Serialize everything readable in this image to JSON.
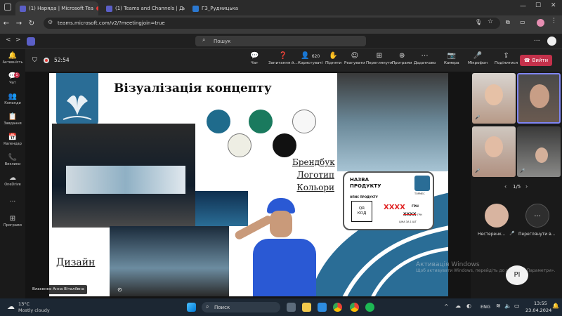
{
  "browser": {
    "tabs": [
      {
        "label": "(1) Наряда | Microsoft Tea",
        "active": true,
        "recording": true
      },
      {
        "label": "(1) Teams and Channels | Ди",
        "active": false
      },
      {
        "label": "ГЗ_Рудницька",
        "active": false
      }
    ],
    "url": "teams.microsoft.com/v2/?meetingjoin=true"
  },
  "teams": {
    "search_placeholder": "Пошук",
    "more": "...",
    "rail": [
      {
        "icon": "bell-icon",
        "label": "Активність"
      },
      {
        "icon": "chat-icon",
        "label": "Чат",
        "badge": "1"
      },
      {
        "icon": "teams-icon",
        "label": "Команди"
      },
      {
        "icon": "assignments-icon",
        "label": "Завдання"
      },
      {
        "icon": "calendar-icon",
        "label": "Календар"
      },
      {
        "icon": "calls-icon",
        "label": "Виклики"
      },
      {
        "icon": "onedrive-icon",
        "label": "OneDrive"
      },
      {
        "icon": "more-icon",
        "label": "..."
      },
      {
        "icon": "apps-icon",
        "label": "Програми"
      }
    ],
    "meeting": {
      "timer": "52:54",
      "buttons": [
        {
          "icon": "chat-icon",
          "label": "Чат"
        },
        {
          "icon": "qa-icon",
          "label": "Запитання й..."
        },
        {
          "icon": "people-icon",
          "label": "Користувачі",
          "count": "620"
        },
        {
          "icon": "raise-hand-icon",
          "label": "Підняти"
        },
        {
          "icon": "react-icon",
          "label": "Реагувати"
        },
        {
          "icon": "view-icon",
          "label": "Переглянути"
        },
        {
          "icon": "apps-icon",
          "label": "Програми"
        },
        {
          "icon": "more-icon",
          "label": "Додатково"
        },
        {
          "icon": "camera-icon",
          "label": "Камера"
        },
        {
          "icon": "mic-icon",
          "label": "Мікрофон"
        },
        {
          "icon": "share-icon",
          "label": "Поділитися"
        }
      ],
      "leave_label": "Вийти"
    },
    "slide": {
      "title": "Візуалізація концепту",
      "labels": [
        "Брендбук",
        "Логотип",
        "Кольори"
      ],
      "design_label": "Дизайн",
      "colors": [
        "#1f6b8c",
        "#1a7a5e",
        "#f7f7f7",
        "#eeeee4",
        "#111111"
      ],
      "price_card": {
        "name_line1": "НАЗВА",
        "name_line2": "ПРОДУКТУ",
        "description": "ОПИС ПРОДУКТУ",
        "qr_line1": "QR",
        "qr_line2": "КОД",
        "price": "XXXX",
        "old_price": "XXXX",
        "currency": "ГРН",
        "unit_price": "ЦІНА ЗА 1 ШТ",
        "brand": "ТОРМЕС"
      }
    },
    "presenter_name": "Власенко Анна Віталіївна",
    "side_panel": {
      "page": "1/5",
      "participants": [
        {
          "name": "Нестеренк...",
          "initials": ""
        },
        {
          "name": "Переглянути в...",
          "initials": "..."
        }
      ],
      "overlay_initials": "PI"
    },
    "watermark": {
      "title": "Активація Windows",
      "subtitle": "Щоб активувати Windows, перейдіть до розділу «Параметри»."
    }
  },
  "taskbar": {
    "weather_temp": "13°C",
    "weather_desc": "Mostly cloudy",
    "search_placeholder": "Поиск",
    "language": "ENG",
    "time": "13:55",
    "date": "23.04.2024"
  }
}
